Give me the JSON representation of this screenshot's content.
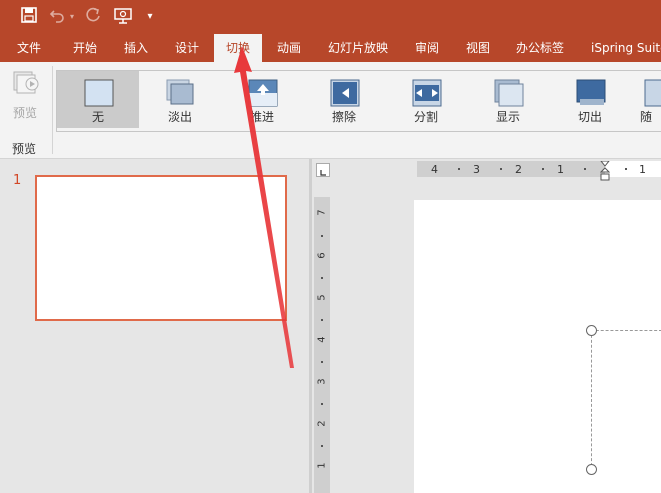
{
  "quick_access": {
    "save_icon": "save-icon",
    "undo_icon": "undo-icon",
    "undo_dropdown_icon": "chevron-down-icon",
    "redo_icon": "redo-icon",
    "present_icon": "present-from-beginning-icon",
    "customize_icon": "customize-dropdown-icon"
  },
  "tabs": [
    {
      "label": "文件"
    },
    {
      "label": "开始"
    },
    {
      "label": "插入"
    },
    {
      "label": "设计"
    },
    {
      "label": "切换",
      "active": true
    },
    {
      "label": "动画"
    },
    {
      "label": "幻灯片放映"
    },
    {
      "label": "审阅"
    },
    {
      "label": "视图"
    },
    {
      "label": "办公标签"
    },
    {
      "label": "iSpring Suite"
    }
  ],
  "ribbon": {
    "preview": {
      "label": "预览",
      "group_label": "预览"
    },
    "transitions": [
      {
        "label": "无",
        "selected": true
      },
      {
        "label": "淡出"
      },
      {
        "label": "推进"
      },
      {
        "label": "擦除"
      },
      {
        "label": "分割"
      },
      {
        "label": "显示"
      },
      {
        "label": "切出"
      },
      {
        "label": "随"
      }
    ]
  },
  "thumbnails": {
    "slide_number": "1"
  },
  "ruler": {
    "horizontal_ticks": [
      "4",
      "3",
      "2",
      "1",
      "1"
    ],
    "vertical_ticks": [
      "7",
      "6",
      "5",
      "4",
      "3",
      "2",
      "1"
    ]
  },
  "colors": {
    "accent": "#b7472a",
    "ribbon_bg": "#f3f3f3",
    "thumb_border": "#e06a4a",
    "arrow": "#e8373a"
  }
}
